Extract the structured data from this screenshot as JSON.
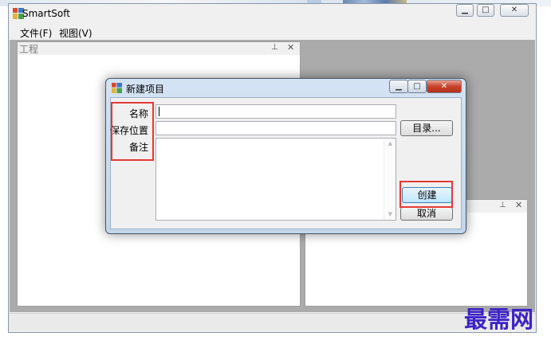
{
  "window": {
    "title": "SmartSoft"
  },
  "menu": {
    "items": [
      {
        "label": "文件(F)"
      },
      {
        "label": "视图(V)"
      }
    ]
  },
  "panels": {
    "project": {
      "title": "工程"
    }
  },
  "dialog": {
    "title": "新建项目",
    "labels": {
      "name": "名称",
      "location": "保存位置",
      "remark": "备注"
    },
    "fields": {
      "name": "",
      "location": "",
      "remark": ""
    },
    "buttons": {
      "browse": "目录...",
      "create": "创建",
      "cancel": "取消"
    }
  },
  "watermark": {
    "text": "最需网"
  },
  "colors": {
    "highlight": "#e53935",
    "watermark": "#3d22c8"
  }
}
